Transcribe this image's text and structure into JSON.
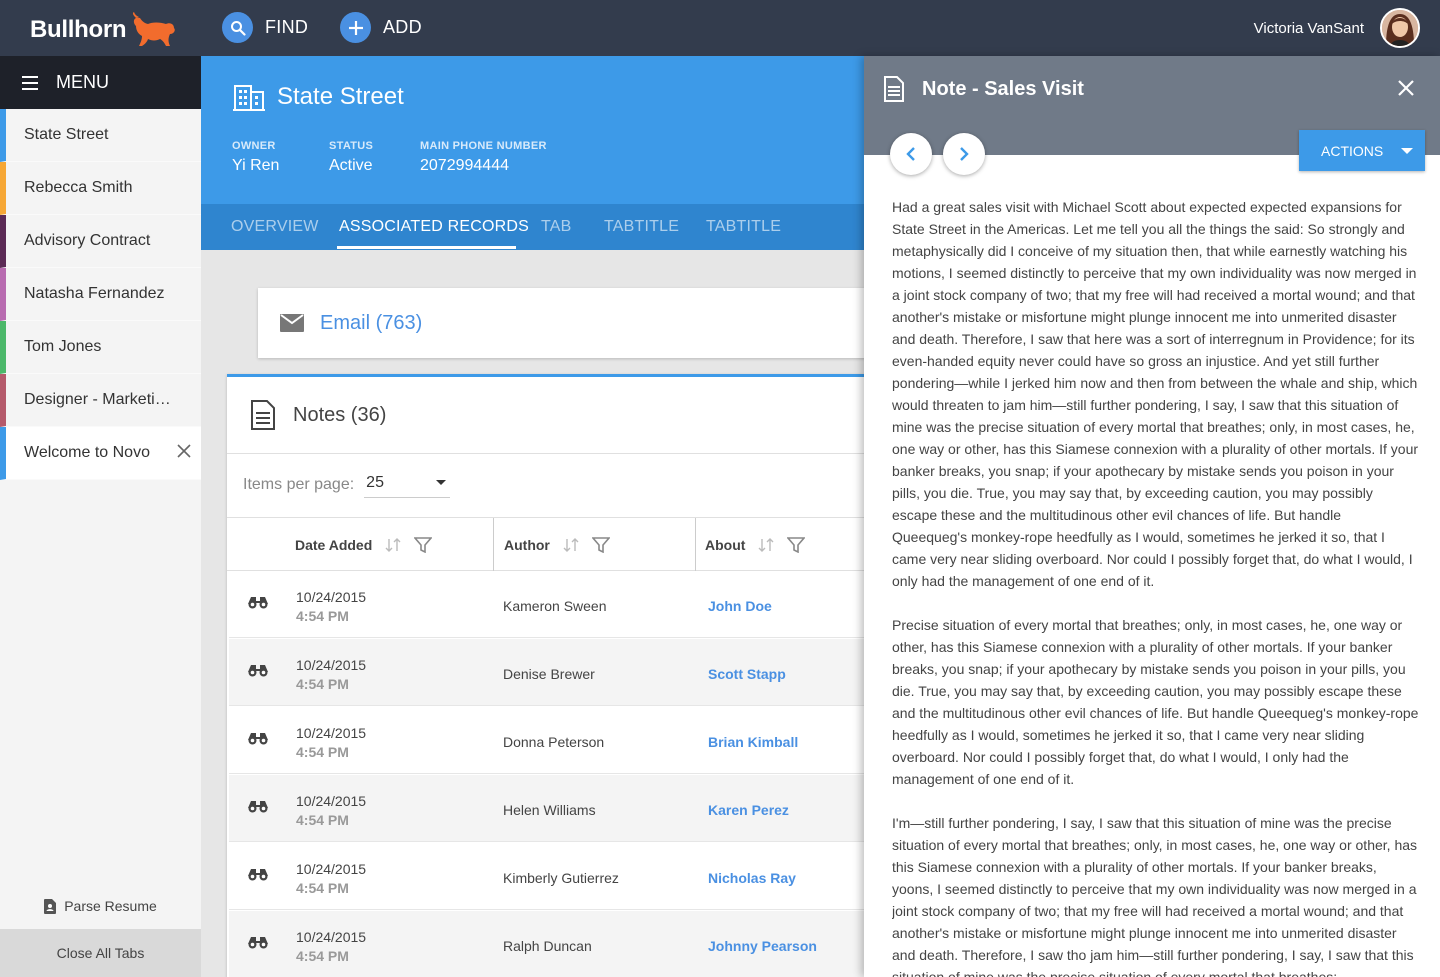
{
  "topbar": {
    "logo_text": "Bullhorn",
    "find_label": "FIND",
    "add_label": "ADD",
    "user_name": "Victoria VanSant"
  },
  "sidebar": {
    "menu_label": "MENU",
    "items": [
      {
        "label": "State Street",
        "color": "#3d9ae8"
      },
      {
        "label": "Rebecca Smith",
        "color": "#f6a735"
      },
      {
        "label": "Advisory Contract",
        "color": "#5b2a55"
      },
      {
        "label": "Natasha Fernandez",
        "color": "#b86bb0"
      },
      {
        "label": "Tom Jones",
        "color": "#4cb86a"
      },
      {
        "label": "Designer - Marketi…",
        "color": "#b55a6b"
      },
      {
        "label": "Welcome to Novo",
        "color": "#3d9ae8"
      }
    ],
    "parse_resume": "Parse Resume",
    "close_all": "Close All Tabs"
  },
  "record": {
    "title": "State Street",
    "owner_label": "OWNER",
    "owner_value": "Yi Ren",
    "status_label": "STATUS",
    "status_value": "Active",
    "phone_label": "MAIN PHONE NUMBER",
    "phone_value": "2072994444",
    "tabs": [
      "OVERVIEW",
      "ASSOCIATED RECORDS",
      "TAB",
      "TABTITLE",
      "TABTITLE"
    ]
  },
  "email": {
    "label": "Email (763)"
  },
  "notes": {
    "title": "Notes (36)",
    "items_per_page_label": "Items per page:",
    "items_per_page_value": "25",
    "columns": {
      "date": "Date Added",
      "author": "Author",
      "about": "About"
    },
    "rows": [
      {
        "date": "10/24/2015",
        "time": "4:54 PM",
        "author": "Kameron Sween",
        "about": "John Doe"
      },
      {
        "date": "10/24/2015",
        "time": "4:54 PM",
        "author": "Denise Brewer",
        "about": "Scott Stapp"
      },
      {
        "date": "10/24/2015",
        "time": "4:54 PM",
        "author": "Donna Peterson",
        "about": "Brian Kimball"
      },
      {
        "date": "10/24/2015",
        "time": "4:54 PM",
        "author": "Helen Williams",
        "about": "Karen Perez"
      },
      {
        "date": "10/24/2015",
        "time": "4:54 PM",
        "author": "Kimberly Gutierrez",
        "about": "Nicholas Ray"
      },
      {
        "date": "10/24/2015",
        "time": "4:54 PM",
        "author": "Ralph Duncan",
        "about": "Johnny Pearson"
      }
    ]
  },
  "note_panel": {
    "title": "Note - Sales Visit",
    "actions_label": "ACTIONS",
    "paragraphs": [
      "Had a great sales visit with Michael Scott about expected expected expansions for State Street in the Americas. Let me tell you all the things the said:  So strongly and metaphysically did I conceive of my situation then, that while earnestly watching his motions, I seemed distinctly to perceive that my own individuality was now merged in a joint stock company of two; that my free will had received a mortal wound; and that another's mistake or misfortune might plunge innocent me into unmerited disaster and death. Therefore, I saw that here was a sort of interregnum in Providence; for its even-handed equity never could have so gross an injustice. And yet still further pondering—while I jerked him now and then from between the whale and ship, which would threaten to jam him—still further pondering, I say, I saw that this situation of mine was the precise situation of every mortal that breathes; only, in most cases, he, one way or other, has this Siamese connexion with a plurality of other mortals. If your banker breaks, you snap; if your apothecary by mistake sends you poison in your pills, you die. True, you may say that, by exceeding caution, you may possibly escape these and the multitudinous other evil chances of life. But handle Queequeg's monkey-rope heedfully as I would, sometimes he jerked it so, that I came very near sliding overboard. Nor could I possibly forget that, do what I would, I only had the management of one end of it.",
      "Precise situation of every mortal that breathes; only, in most cases, he, one way or other, has this Siamese connexion with a plurality of other mortals. If your banker breaks, you snap; if your apothecary by mistake sends you poison in your pills, you die. True, you may say that, by exceeding caution, you may possibly escape these and the multitudinous other evil chances of life. But handle Queequeg's monkey-rope heedfully as I would, sometimes he jerked it so, that I came very near sliding overboard. Nor could I possibly forget that, do what I would, I only had the management of one end of it.",
      "I'm—still further pondering, I say, I saw that this situation of mine was the precise situation of every mortal that breathes; only, in most cases, he, one way or other, has this Siamese connexion with a plurality of other mortals. If your banker breaks, yoons, I seemed distinctly to perceive that my own individuality was now merged in a joint stock company of two; that my free will had received a mortal wound; and that another's mistake or misfortune might plunge innocent me into unmerited disaster and death. Therefore, I saw tho jam him—still further pondering, I say, I saw that this situation of mine was the precise situation of every mortal that breathes;"
    ]
  },
  "colors": {
    "topbar": "#333c4d",
    "accent": "#3d9ae8",
    "tabbar": "#2f85cf",
    "note_header": "#707a88",
    "link": "#4a90e2"
  }
}
